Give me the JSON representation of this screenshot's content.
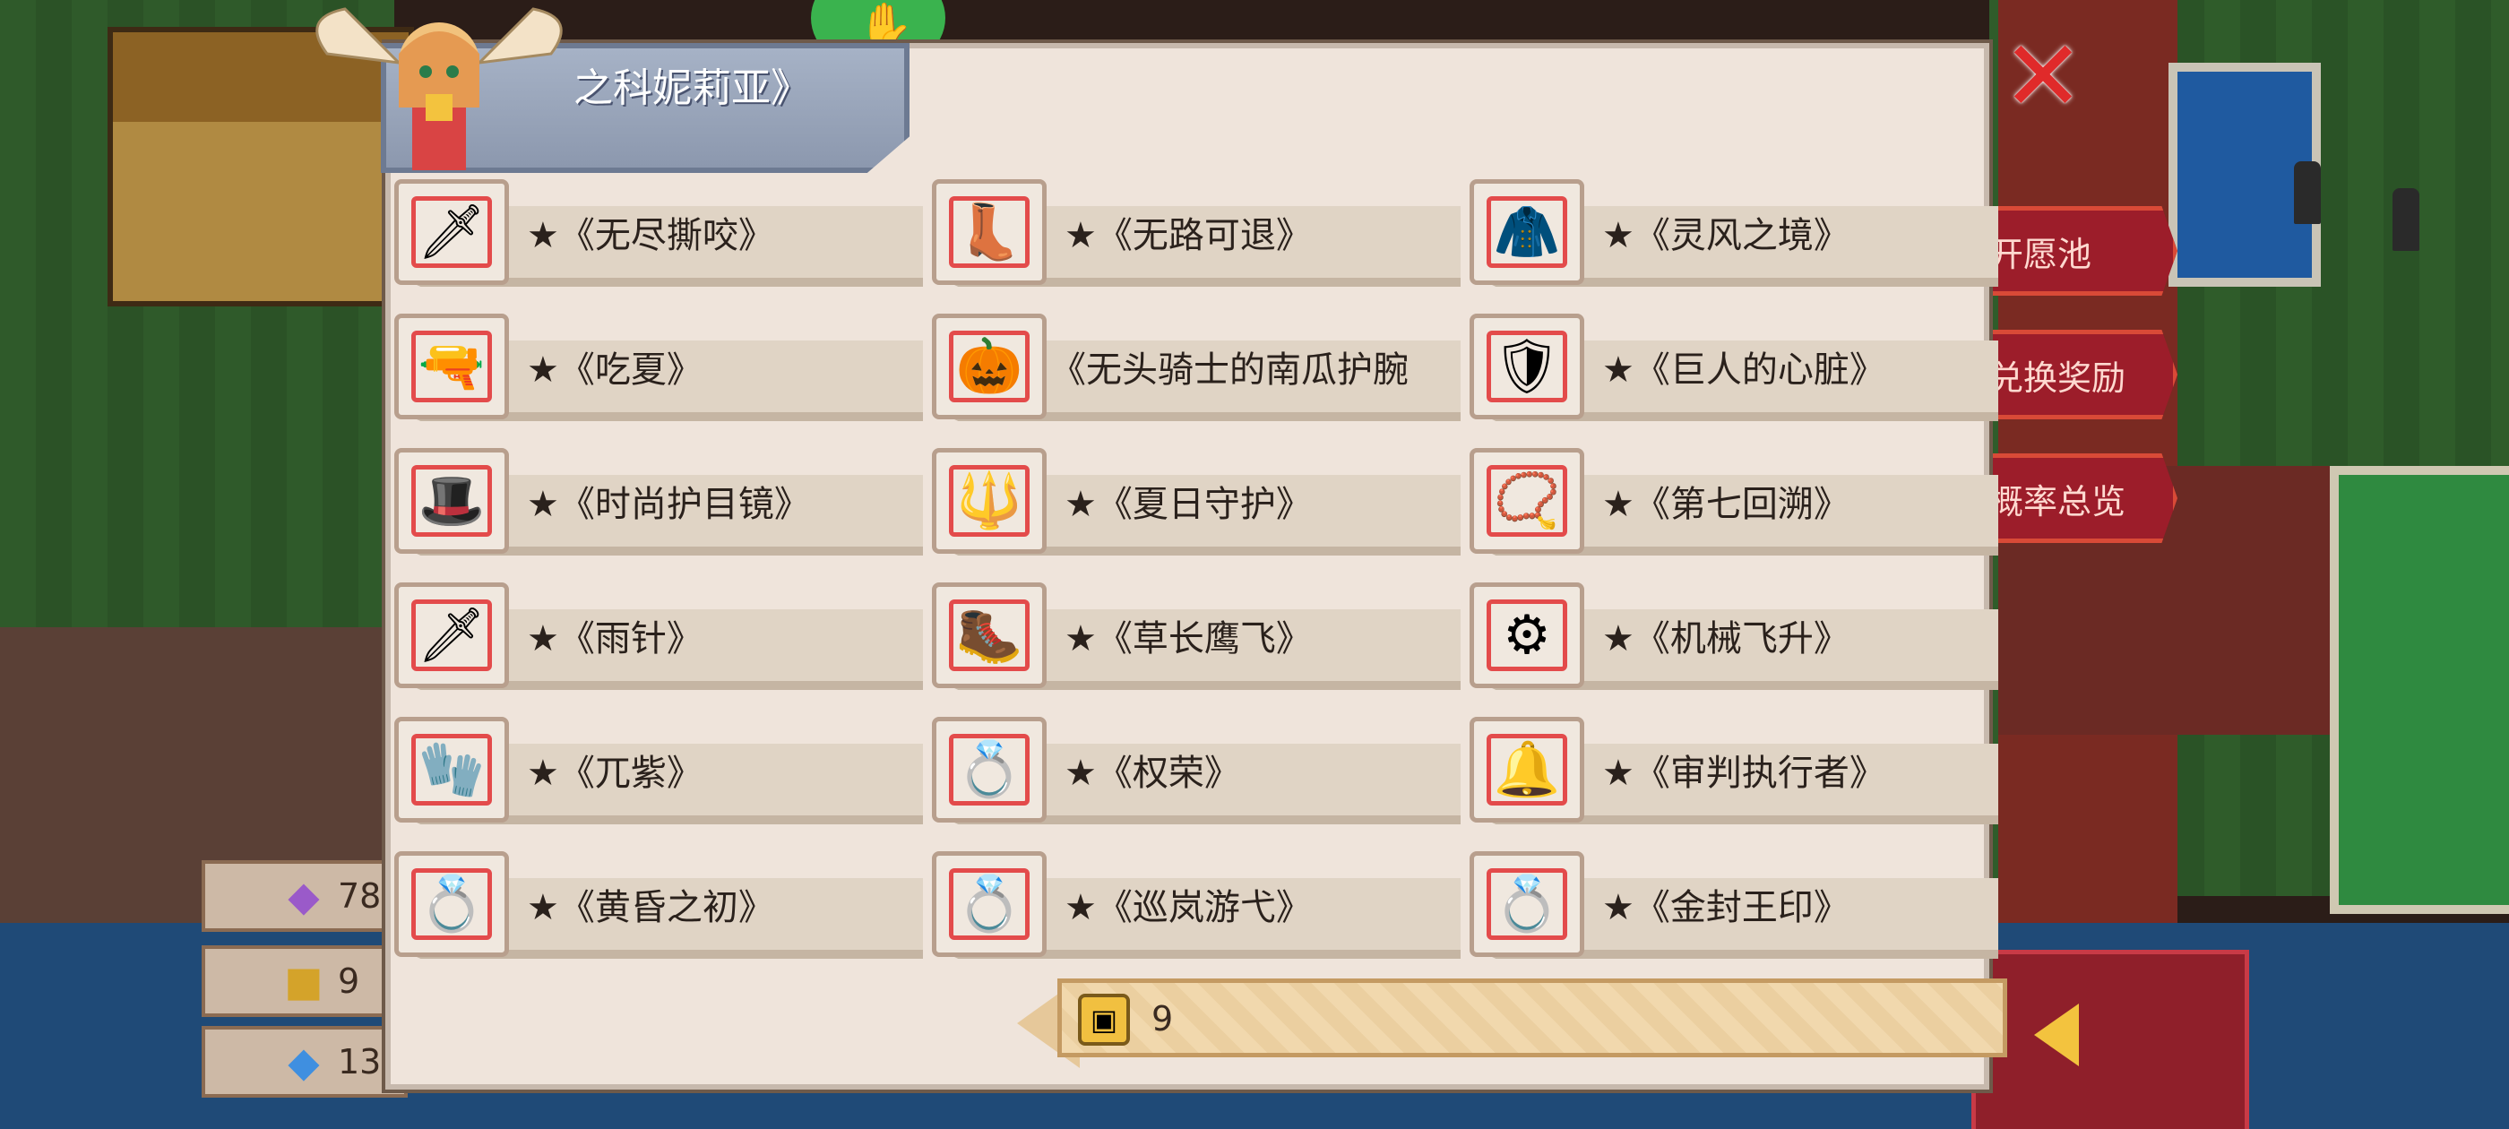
{
  "title": "《普露之科妮莉亚》",
  "title_visible": "之科妮莉亚》",
  "side_menu": [
    {
      "label": "开愿池",
      "visible": "开愿池"
    },
    {
      "label": "兑换奖励",
      "visible": "兑换奖励"
    },
    {
      "label": "概率总览",
      "visible": "概率总览"
    }
  ],
  "currencies": [
    {
      "icon": "crystal-icon",
      "value": "78"
    },
    {
      "icon": "token-icon",
      "value": "9"
    },
    {
      "icon": "gem-icon",
      "value": "13"
    }
  ],
  "items": [
    {
      "name": "★《无尽撕咬》",
      "icon": "claw-weapon-icon",
      "art": "🗡"
    },
    {
      "name": "★《无路可退》",
      "icon": "boots-icon",
      "art": "👢"
    },
    {
      "name": "★《灵风之境》",
      "icon": "red-cape-icon",
      "art": "🧥"
    },
    {
      "name": "★《吃夏》",
      "icon": "water-gun-icon",
      "art": "🔫"
    },
    {
      "name": "《无头骑士的南瓜护腕",
      "icon": "pumpkin-icon",
      "art": "🎃"
    },
    {
      "name": "★《巨人的心脏》",
      "icon": "armor-icon",
      "art": "🛡"
    },
    {
      "name": "★《时尚护目镜》",
      "icon": "goggles-hat-icon",
      "art": "🎩"
    },
    {
      "name": "★《夏日守护》",
      "icon": "leaf-blade-icon",
      "art": "🔱"
    },
    {
      "name": "★《第七回溯》",
      "icon": "necklace-icon",
      "art": "📿"
    },
    {
      "name": "★《雨针》",
      "icon": "needle-icon",
      "art": "🗡"
    },
    {
      "name": "★《草长鹰飞》",
      "icon": "winged-boots-icon",
      "art": "🥾"
    },
    {
      "name": "★《机械飞升》",
      "icon": "mech-wing-icon",
      "art": "⚙"
    },
    {
      "name": "★《兀紫》",
      "icon": "gauntlet-icon",
      "art": "🧤"
    },
    {
      "name": "★《权荣》",
      "icon": "gold-ring-icon",
      "art": "💍"
    },
    {
      "name": "★《审判执行者》",
      "icon": "robe-icon",
      "art": "🔔"
    },
    {
      "name": "★《黄昏之初》",
      "icon": "blue-ring-icon",
      "art": "💍"
    },
    {
      "name": "★《巡岚游弋》",
      "icon": "wing-ring-icon",
      "art": "💍"
    },
    {
      "name": "★《金封王印》",
      "icon": "gold-seal-ring-icon",
      "art": "💍"
    }
  ],
  "counter": {
    "icon": "token-icon",
    "value": "9"
  },
  "colors": {
    "accent_red": "#e34b4b",
    "panel": "#efe4db",
    "side_btn": "#9c1d2a"
  }
}
